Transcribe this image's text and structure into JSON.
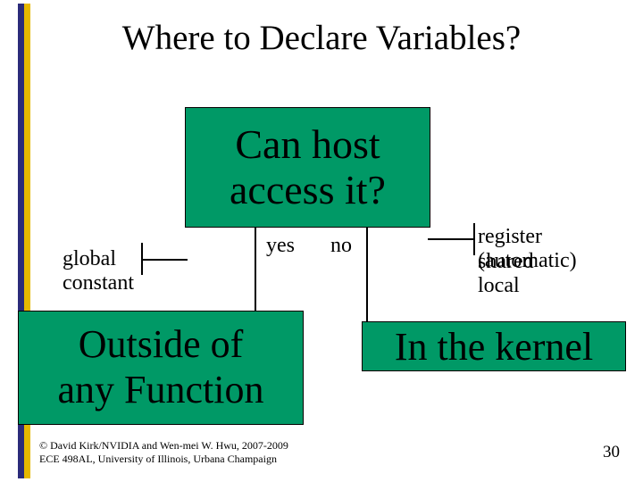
{
  "title": "Where to Declare Variables?",
  "boxes": {
    "top_line1": "Can host",
    "top_line2": "access it?",
    "left_line1": "Outside of",
    "left_line2": "any Function",
    "right": "In the kernel"
  },
  "edges": {
    "yes": "yes",
    "no": "no"
  },
  "left_labels": {
    "global": "global",
    "constant": "constant"
  },
  "right_labels": {
    "register": "register (automatic)",
    "shared": "shared",
    "local": "local"
  },
  "footer": {
    "line1": "© David Kirk/NVIDIA and Wen-mei W. Hwu, 2007-2009",
    "line2": "ECE 498AL, University of Illinois, Urbana Champaign"
  },
  "slide_number": "30"
}
